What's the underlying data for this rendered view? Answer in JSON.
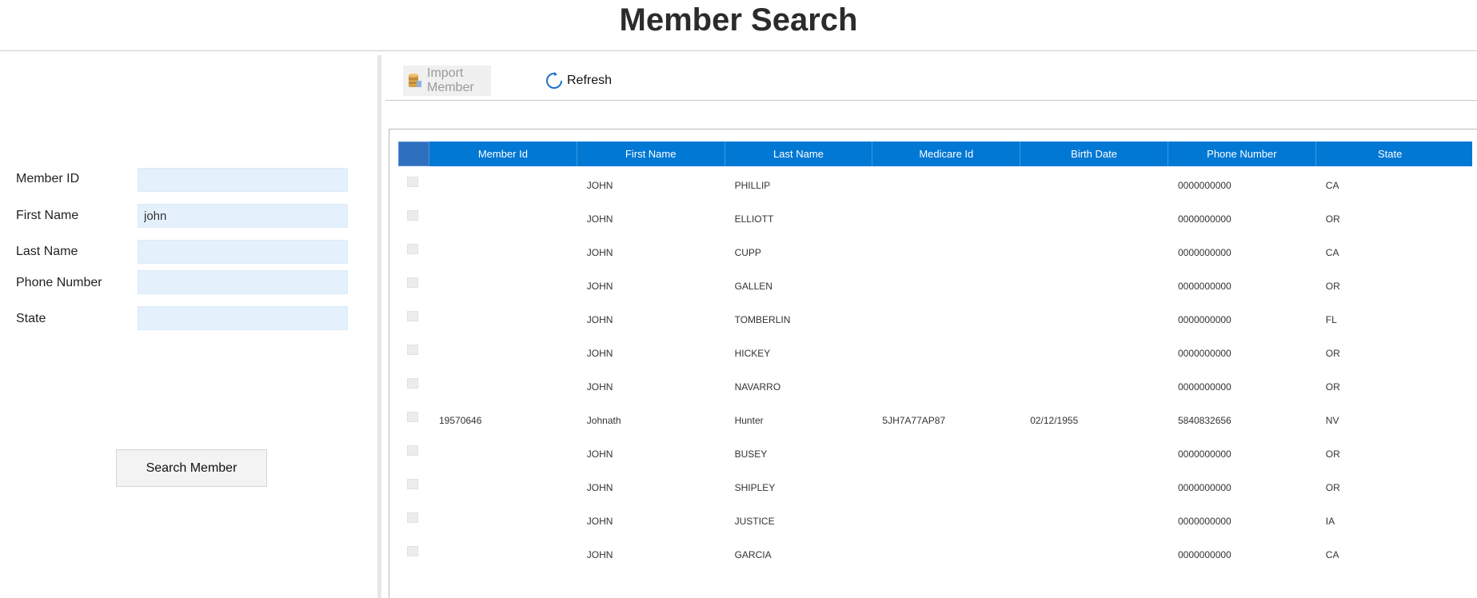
{
  "header": {
    "title": "Member Search"
  },
  "form": {
    "fields": [
      {
        "label": "Member ID",
        "value": "",
        "placeholder": ""
      },
      {
        "label": "First Name",
        "value": "john",
        "placeholder": ""
      },
      {
        "label": "Last Name",
        "value": "",
        "placeholder": ""
      },
      {
        "label": "Phone Number",
        "value": "",
        "placeholder": ""
      },
      {
        "label": "State",
        "value": "",
        "placeholder": ""
      }
    ],
    "search_label": "Search Member"
  },
  "toolbar": {
    "import_label": "Import Member",
    "import_icon": "import-database-icon",
    "refresh_label": "Refresh",
    "refresh_icon": "refresh-icon"
  },
  "grid": {
    "columns": [
      "Member Id",
      "First Name",
      "Last Name",
      "Medicare Id",
      "Birth Date",
      "Phone Number",
      "State"
    ],
    "rows": [
      [
        "",
        "JOHN",
        "PHILLIP",
        "",
        "",
        "0000000000",
        "CA"
      ],
      [
        "",
        "JOHN",
        "ELLIOTT",
        "",
        "",
        "0000000000",
        "OR"
      ],
      [
        "",
        "JOHN",
        "CUPP",
        "",
        "",
        "0000000000",
        "CA"
      ],
      [
        "",
        "JOHN",
        "GALLEN",
        "",
        "",
        "0000000000",
        "OR"
      ],
      [
        "",
        "JOHN",
        "TOMBERLIN",
        "",
        "",
        "0000000000",
        "FL"
      ],
      [
        "",
        "JOHN",
        "HICKEY",
        "",
        "",
        "0000000000",
        "OR"
      ],
      [
        "",
        "JOHN",
        "NAVARRO",
        "",
        "",
        "0000000000",
        "OR"
      ],
      [
        "19570646",
        "Johnath",
        "Hunter",
        "5JH7A77AP87",
        "02/12/1955",
        "5840832656",
        "NV"
      ],
      [
        "",
        "JOHN",
        "BUSEY",
        "",
        "",
        "0000000000",
        "OR"
      ],
      [
        "",
        "JOHN",
        "SHIPLEY",
        "",
        "",
        "0000000000",
        "OR"
      ],
      [
        "",
        "JOHN",
        "JUSTICE",
        "",
        "",
        "0000000000",
        "IA"
      ],
      [
        "",
        "JOHN",
        "GARCIA",
        "",
        "",
        "0000000000",
        "CA"
      ]
    ]
  },
  "colors": {
    "header_blue": "#0078d4",
    "input_bg": "#e4f1fc"
  }
}
